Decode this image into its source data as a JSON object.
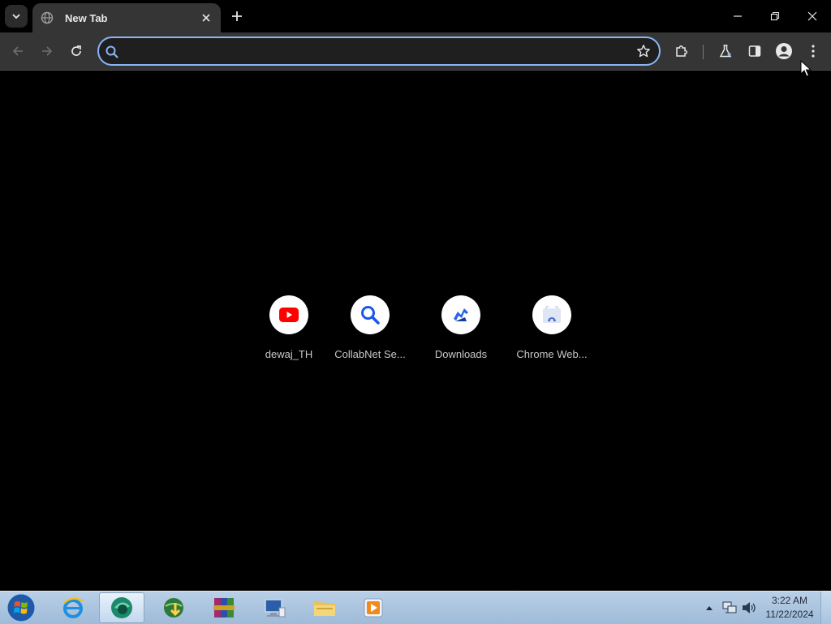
{
  "browser": {
    "tab_title": "New Tab",
    "omnibox_value": "",
    "omnibox_placeholder": ""
  },
  "shortcuts": [
    {
      "label": "dewaj_TH",
      "icon": "youtube-icon"
    },
    {
      "label": "CollabNet Se...",
      "icon": "search-icon"
    },
    {
      "label": "Downloads",
      "icon": "downloads-icon"
    },
    {
      "label": "Chrome Web...",
      "icon": "chrome-web-store-icon"
    }
  ],
  "taskbar": {
    "apps": [
      "internet-explorer",
      "chrome-like-browser",
      "network-globe",
      "winrar",
      "remote-computer",
      "file-explorer",
      "media-player"
    ],
    "clock_time": "3:22 AM",
    "clock_date": "11/22/2024"
  },
  "colors": {
    "accent_focus": "#8ab4f8",
    "youtube_red": "#ff0000",
    "search_blue": "#1a56e8"
  }
}
